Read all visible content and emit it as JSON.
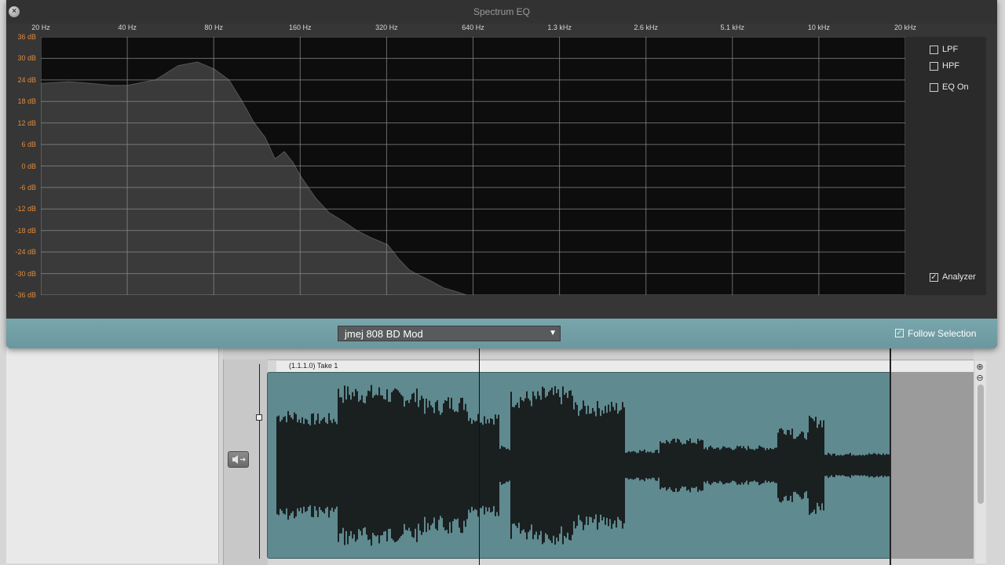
{
  "window": {
    "title": "Spectrum EQ",
    "close_icon": "close-icon"
  },
  "eq": {
    "freq_labels": [
      "20 Hz",
      "40 Hz",
      "80 Hz",
      "160 Hz",
      "320 Hz",
      "640 Hz",
      "1.3 kHz",
      "2.6 kHz",
      "5.1 kHz",
      "10 kHz",
      "20 kHz"
    ],
    "db_labels": [
      "36 dB",
      "30 dB",
      "24 dB",
      "18 dB",
      "12 dB",
      "6 dB",
      "0 dB",
      "-6 dB",
      "-12 dB",
      "-18 dB",
      "-24 dB",
      "-30 dB",
      "-36 dB"
    ],
    "options": {
      "lpf": {
        "label": "LPF",
        "checked": false
      },
      "hpf": {
        "label": "HPF",
        "checked": false
      },
      "eq_on": {
        "label": "EQ On",
        "checked": false
      },
      "analyzer": {
        "label": "Analyzer",
        "checked": true
      }
    },
    "preset": "jmej 808 BD Mod",
    "follow_selection": {
      "label": "Follow Selection",
      "checked": true
    },
    "colors": {
      "db_label": "#e08a3c",
      "grid": "#8a8a8a",
      "spectrum": "#3a3a3a"
    }
  },
  "chart_data": {
    "type": "area",
    "x_scale": "log",
    "xlabel": "",
    "ylabel": "",
    "xlim": [
      20,
      20000
    ],
    "ylim": [
      -36,
      36
    ],
    "grid": true,
    "x": [
      20,
      25,
      30,
      35,
      40,
      50,
      60,
      70,
      80,
      90,
      100,
      110,
      120,
      130,
      140,
      150,
      160,
      180,
      200,
      220,
      250,
      280,
      300,
      320,
      350,
      380,
      400,
      450,
      500,
      550,
      600
    ],
    "y": [
      23,
      23.5,
      23,
      22.5,
      22.5,
      24,
      28,
      29,
      27,
      24,
      18,
      12,
      8,
      2,
      4,
      1,
      -3,
      -9,
      -13,
      -15,
      -18,
      -20,
      -21,
      -22,
      -26,
      -29,
      -30,
      -32,
      -34,
      -35,
      -36
    ]
  },
  "editor": {
    "region_title": "(1.1.1.0) Take 1",
    "speaker_icon": "speaker-icon",
    "zoom_in_icon": "zoom-in-icon",
    "zoom_out_icon": "zoom-out-icon"
  }
}
